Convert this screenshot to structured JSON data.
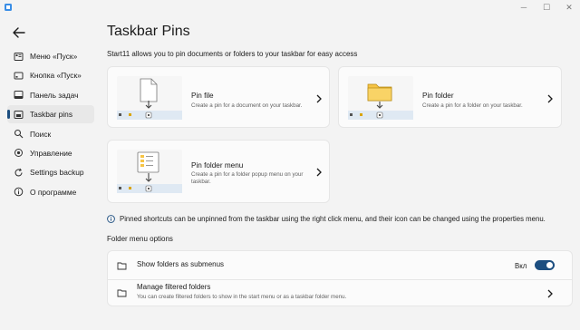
{
  "window": {
    "minimize_glyph": "─",
    "maximize_glyph": "☐",
    "close_glyph": "✕"
  },
  "sidebar": {
    "items": [
      {
        "label": "Меню «Пуск»",
        "icon": "start-menu-icon"
      },
      {
        "label": "Кнопка «Пуск»",
        "icon": "start-button-icon"
      },
      {
        "label": "Панель задач",
        "icon": "taskbar-icon"
      },
      {
        "label": "Taskbar pins",
        "icon": "pin-icon",
        "active": true
      },
      {
        "label": "Поиск",
        "icon": "search-icon"
      },
      {
        "label": "Управление",
        "icon": "control-icon"
      },
      {
        "label": "Settings backup",
        "icon": "backup-icon"
      },
      {
        "label": "О программе",
        "icon": "info-icon"
      }
    ]
  },
  "main": {
    "title": "Taskbar Pins",
    "description": "Start11 allows you to pin documents or folders to your taskbar for easy access",
    "cards": [
      {
        "title": "Pin file",
        "subtitle": "Create a pin for a document on your taskbar."
      },
      {
        "title": "Pin folder",
        "subtitle": "Create a pin for a folder on your taskbar."
      },
      {
        "title": "Pin folder menu",
        "subtitle": "Create a pin for a folder popup menu on your taskbar."
      }
    ],
    "info_text": "Pinned shortcuts can be unpinned from the taskbar using the right click menu, and their icon can be changed using the properties menu.",
    "folder_options": {
      "section_title": "Folder menu options",
      "show_folders": {
        "label": "Show folders as submenus",
        "toggle_label": "Вкл",
        "toggle_on": true
      },
      "manage_filtered": {
        "label": "Manage filtered folders",
        "subtitle": "You can create filtered folders to show in the start menu or as a taskbar folder menu."
      }
    }
  },
  "colors": {
    "accent": "#1c4e80",
    "background": "#f3f3f3",
    "card": "#fbfbfb",
    "folder_yellow": "#f6c445"
  }
}
